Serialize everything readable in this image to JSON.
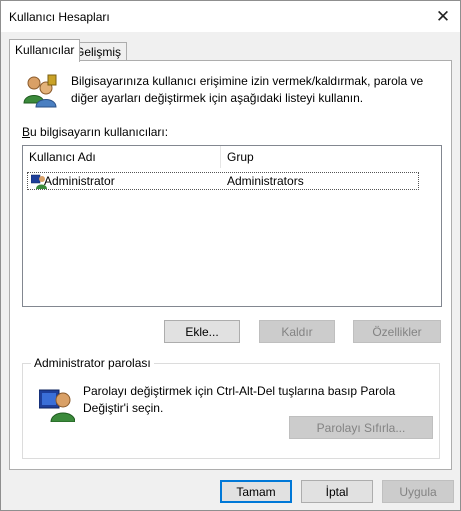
{
  "window": {
    "title": "Kullanıcı Hesapları",
    "close_glyph": "✕"
  },
  "tabs": [
    {
      "label": "Kullanıcılar",
      "active": true
    },
    {
      "label": "Gelişmiş",
      "active": false
    }
  ],
  "users_tab": {
    "intro_text": "Bilgisayarınıza kullanıcı erişimine izin vermek/kaldırmak, parola ve diğer ayarları değiştirmek için aşağıdaki listeyi kullanın.",
    "list_label": "Bu bilgisayarın kullanıcıları:",
    "columns": [
      "Kullanıcı Adı",
      "Grup"
    ],
    "rows": [
      {
        "name": "Administrator",
        "group": "Administrators",
        "icon": "user-admin-icon"
      }
    ],
    "buttons": {
      "add": "Ekle...",
      "remove": "Kaldır",
      "properties": "Özellikler"
    },
    "password_group": {
      "legend": "Administrator parolası",
      "text": "Parolayı değiştirmek için Ctrl-Alt-Del tuşlarına basıp Parola Değiştir'i seçin.",
      "reset_button": "Parolayı Sıfırla..."
    }
  },
  "dialog_buttons": {
    "ok": "Tamam",
    "cancel": "İptal",
    "apply": "Uygula"
  },
  "colors": {
    "accent": "#0078d7",
    "disabled_text": "#838383",
    "window_bg": "#f0f0f0"
  }
}
